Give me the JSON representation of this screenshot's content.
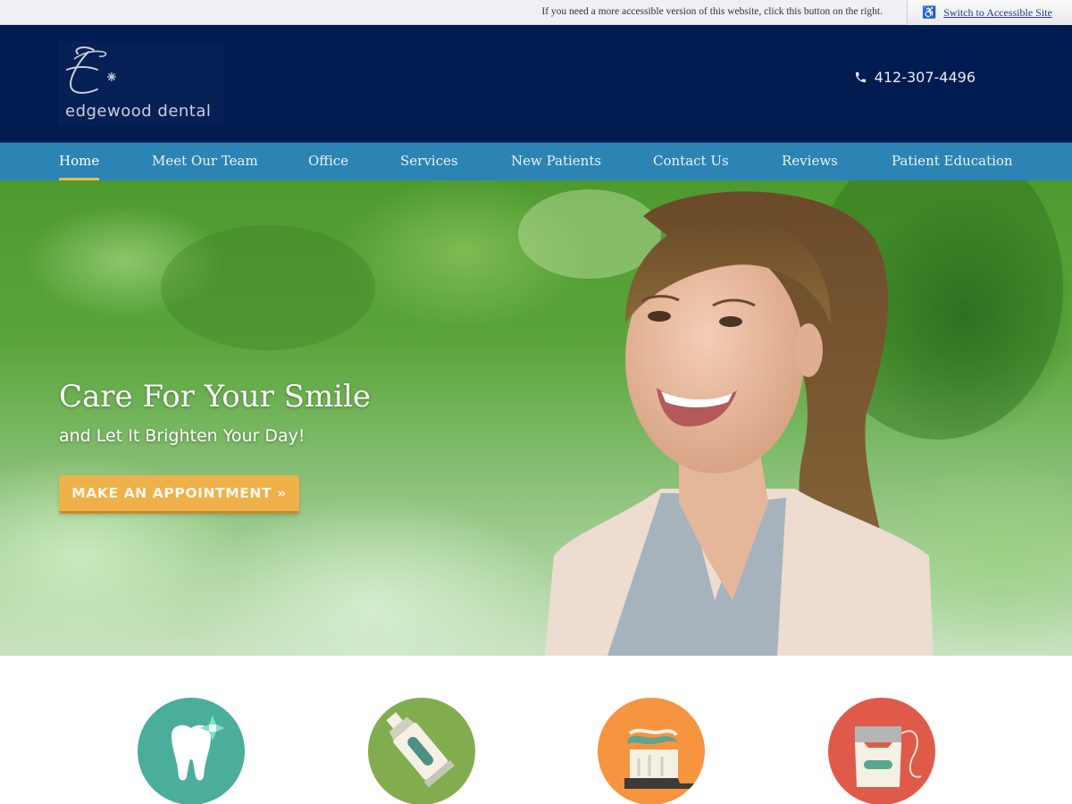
{
  "accessibility_bar": {
    "note": "If you need a more accessible version of this website, click this button on the right.",
    "button_label": "Switch to Accessible Site",
    "button_icon": "wheelchair-icon"
  },
  "header": {
    "logo_text": "edgewood dental",
    "logo_monogram": "E",
    "phone": "412-307-4496",
    "phone_icon": "phone-icon"
  },
  "nav": {
    "items": [
      {
        "label": "Home",
        "active": true
      },
      {
        "label": "Meet Our Team",
        "active": false
      },
      {
        "label": "Office",
        "active": false
      },
      {
        "label": "Services",
        "active": false
      },
      {
        "label": "New Patients",
        "active": false
      },
      {
        "label": "Contact Us",
        "active": false
      },
      {
        "label": "Reviews",
        "active": false
      },
      {
        "label": "Patient Education",
        "active": false
      }
    ]
  },
  "hero": {
    "title": "Care For Your Smile",
    "subtitle": "and Let It Brighten Your Day!",
    "cta_label": "MAKE AN APPOINTMENT »",
    "image_description": "smiling young woman with ponytail outdoors"
  },
  "feature_icons": [
    {
      "name": "tooth-sparkle-icon",
      "color": "#4aae9b"
    },
    {
      "name": "toothpaste-tube-icon",
      "color": "#82ad4f"
    },
    {
      "name": "toothbrush-icon",
      "color": "#f7943f"
    },
    {
      "name": "floss-icon",
      "color": "#e05a49"
    }
  ],
  "colors": {
    "header_bg": "#001b50",
    "nav_bg": "#2b84b4",
    "nav_active_underline": "#e9b94a",
    "cta_bg": "#f0b04a"
  }
}
